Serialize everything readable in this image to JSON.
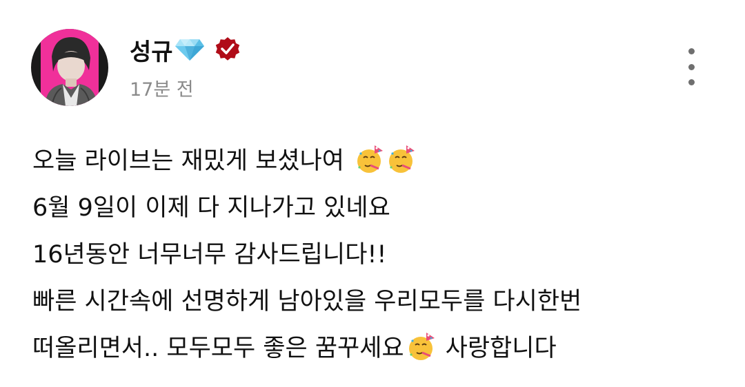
{
  "post": {
    "author": {
      "name": "성규",
      "badge_icon": "diamond-icon",
      "verified_icon": "verified-badge-icon",
      "verified_color": "#b00c18"
    },
    "timestamp": "17분 전",
    "menu_icon": "more-vertical-icon",
    "body": {
      "line1": "오늘 라이브는 재밌게 보셨나여",
      "line2": "6월 9일이 이제 다 지나가고 있네요",
      "line3": "16년동안 너무너무 감사드립니다!!",
      "line4": "빠른 시간속에 선명하게 남아있을 우리모두를 다시한번",
      "line5a": "떠올리면서.. 모두모두 좋은 꿈꾸세요",
      "line5b": "사랑합니다",
      "emoji_icon": "partying-face-emoji"
    },
    "colors": {
      "text": "#111111",
      "muted": "#8a8a8a",
      "avatar_bg": "#f0309a"
    }
  }
}
